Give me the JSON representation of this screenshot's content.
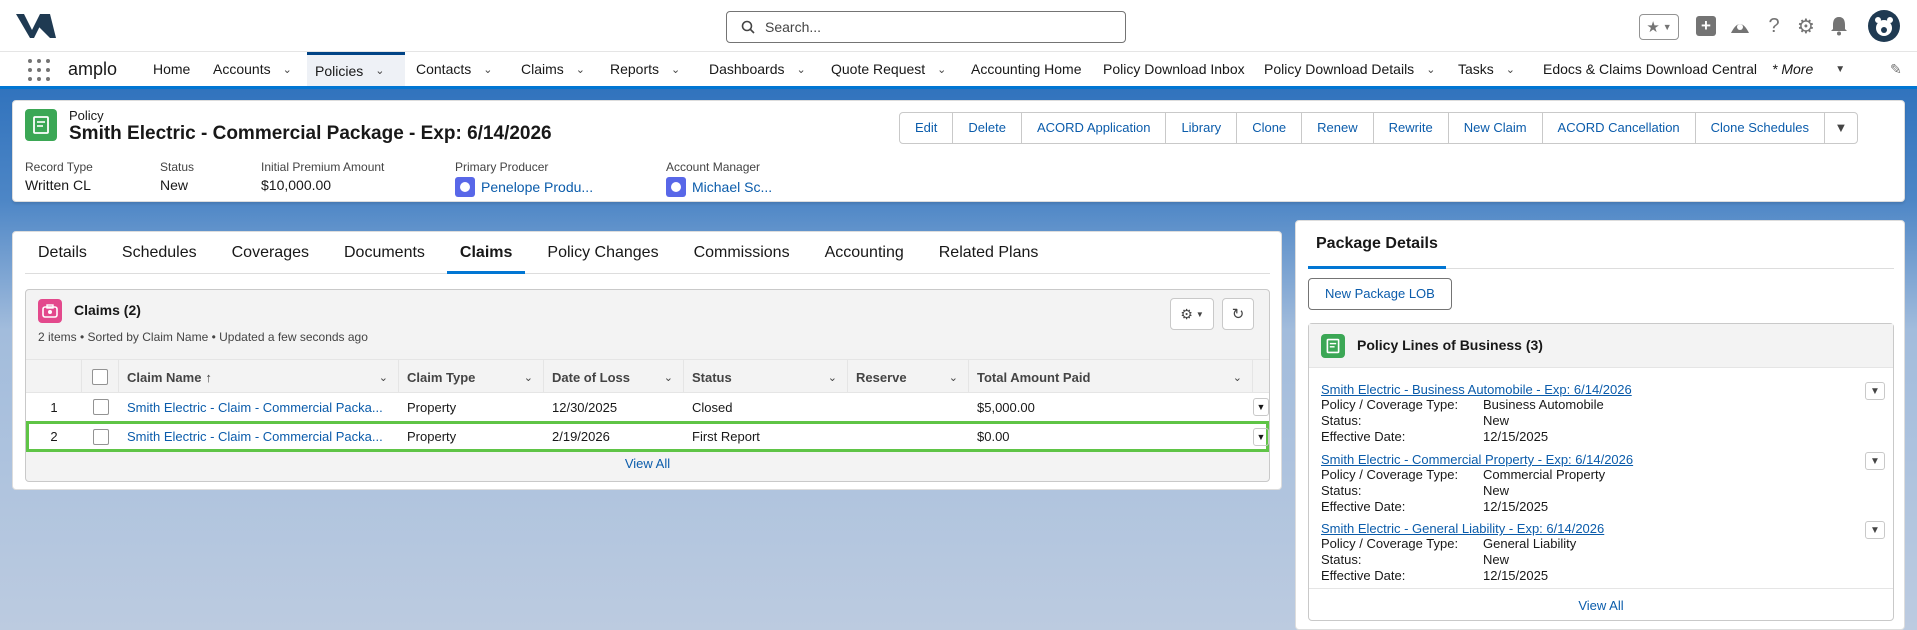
{
  "search": {
    "placeholder": "Search..."
  },
  "app": {
    "name": "amplo"
  },
  "nav": {
    "items": [
      {
        "label": "Home",
        "dropdown": false
      },
      {
        "label": "Accounts",
        "dropdown": true
      },
      {
        "label": "Policies",
        "dropdown": true,
        "active": true
      },
      {
        "label": "Contacts",
        "dropdown": true
      },
      {
        "label": "Claims",
        "dropdown": true
      },
      {
        "label": "Reports",
        "dropdown": true
      },
      {
        "label": "Dashboards",
        "dropdown": true
      },
      {
        "label": "Quote Request",
        "dropdown": true
      },
      {
        "label": "Accounting Home",
        "dropdown": false
      },
      {
        "label": "Policy Download Inbox",
        "dropdown": false
      },
      {
        "label": "Policy Download Details",
        "dropdown": true
      },
      {
        "label": "Tasks",
        "dropdown": true
      },
      {
        "label": "Edocs & Claims Download Central",
        "dropdown": false
      },
      {
        "label": "* More",
        "dropdown": true
      }
    ]
  },
  "record": {
    "object_type": "Policy",
    "title": "Smith Electric - Commercial Package - Exp: 6/14/2026",
    "actions": [
      "Edit",
      "Delete",
      "ACORD Application",
      "Library",
      "Clone",
      "Renew",
      "Rewrite",
      "New Claim",
      "ACORD Cancellation",
      "Clone Schedules"
    ],
    "fields": [
      {
        "label": "Record Type",
        "value": "Written CL"
      },
      {
        "label": "Status",
        "value": "New"
      },
      {
        "label": "Initial Premium Amount",
        "value": "$10,000.00"
      },
      {
        "label": "Primary Producer",
        "value": "Penelope Produ..."
      },
      {
        "label": "Account Manager",
        "value": "Michael Sc..."
      }
    ]
  },
  "tabs": [
    "Details",
    "Schedules",
    "Coverages",
    "Documents",
    "Claims",
    "Policy Changes",
    "Commissions",
    "Accounting",
    "Related Plans"
  ],
  "claims": {
    "title": "Claims (2)",
    "subtitle": "2 items • Sorted by Claim Name • Updated a few seconds ago",
    "columns": [
      "Claim Name",
      "Claim Type",
      "Date of Loss",
      "Status",
      "Reserve",
      "Total Amount Paid"
    ],
    "rows": [
      {
        "num": "1",
        "name": "Smith Electric - Claim - Commercial Packa...",
        "type": "Property",
        "date": "12/30/2025",
        "status": "Closed",
        "reserve": "",
        "paid": "$5,000.00"
      },
      {
        "num": "2",
        "name": "Smith Electric - Claim - Commercial Packa...",
        "type": "Property",
        "date": "2/19/2026",
        "status": "First Report",
        "reserve": "",
        "paid": "$0.00"
      }
    ],
    "view_all": "View All"
  },
  "package": {
    "tab": "Package Details",
    "new_button": "New Package LOB",
    "lob_title": "Policy Lines of Business (3)",
    "labels": {
      "coverage": "Policy / Coverage Type:",
      "status": "Status:",
      "effective": "Effective Date:"
    },
    "items": [
      {
        "title": "Smith Electric - Business Automobile - Exp: 6/14/2026",
        "coverage": "Business Automobile",
        "status": "New",
        "effective": "12/15/2025"
      },
      {
        "title": "Smith Electric - Commercial Property - Exp: 6/14/2026",
        "coverage": "Commercial Property",
        "status": "New",
        "effective": "12/15/2025"
      },
      {
        "title": "Smith Electric - General Liability - Exp: 6/14/2026",
        "coverage": "General Liability",
        "status": "New",
        "effective": "12/15/2025"
      }
    ],
    "view_all": "View All"
  },
  "colors": {
    "brand": "#0176d3",
    "link": "#0b5cab",
    "policy_icon": "#3ba755",
    "claims_icon": "#e3498c",
    "selected_row": "#5fc446"
  }
}
